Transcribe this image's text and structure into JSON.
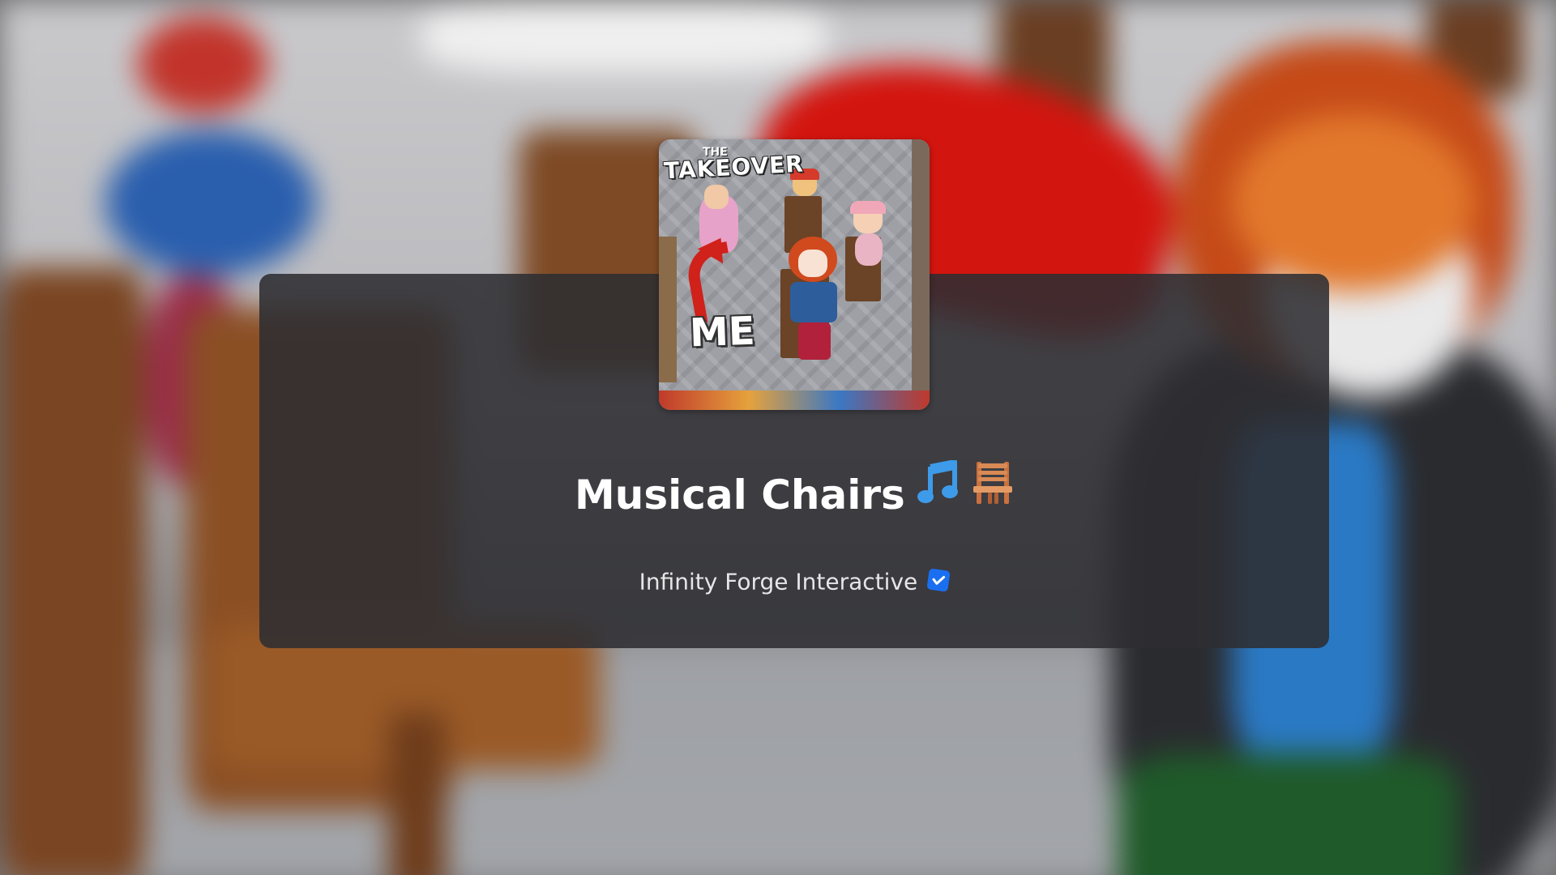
{
  "game": {
    "title": "Musical Chairs",
    "title_emoji_1": "music-note-icon",
    "title_emoji_2": "chair-icon",
    "creator": "Infinity Forge Interactive",
    "creator_verified": true
  },
  "thumbnail": {
    "text_top_small": "THE",
    "text_top": "TAKEOVER",
    "text_me": "ME"
  },
  "colors": {
    "panel": "#2d2e32",
    "verified_badge": "#1a6ff0",
    "title_text": "#ffffff",
    "creator_text": "#e6e6e8"
  }
}
